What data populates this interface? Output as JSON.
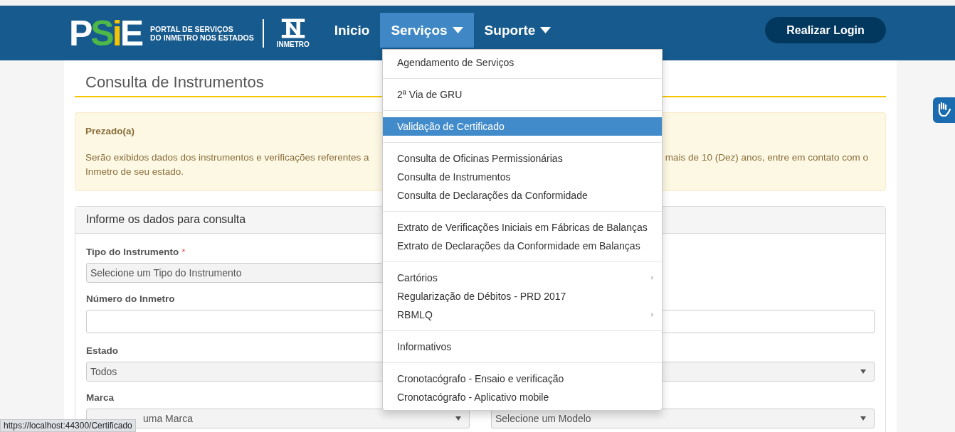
{
  "header": {
    "logo": {
      "letters": [
        {
          "text": "P",
          "color": "#ffffff"
        },
        {
          "text": "S",
          "color": "#4db848"
        },
        {
          "text": "i",
          "color": "#f6c400"
        },
        {
          "text": "E",
          "color": "#ffffff"
        }
      ],
      "tagline": [
        "PORTAL DE SERVIÇOS",
        "DO INMETRO NOS ESTADOS"
      ],
      "brand": "INMETRO"
    },
    "nav": [
      {
        "label": "Inicio",
        "selected": false,
        "has_dropdown": false
      },
      {
        "label": "Serviços",
        "selected": true,
        "has_dropdown": true
      },
      {
        "label": "Suporte",
        "selected": false,
        "has_dropdown": true
      }
    ],
    "login_button": "Realizar Login"
  },
  "page_title": "Consulta de Instrumentos",
  "alert": {
    "title": "Prezado(a)",
    "line_1_left": "Serão exibidos dados dos instrumentos e verificações referentes a",
    "line_1_right": "mais de 10 (Dez) anos, entre em contato com o",
    "line_2": "Inmetro de seu estado."
  },
  "form": {
    "title": "Informe os dados para consulta",
    "rows": [
      {
        "fields": [
          {
            "kind": "short_select",
            "label": "Tipo do Instrumento",
            "required_mark": "*",
            "placeholder": "Selecione um Tipo do Instrumento"
          }
        ]
      },
      {
        "fields": [
          {
            "kind": "input",
            "label": "Número do Inmetro"
          }
        ]
      },
      {
        "fields": [
          {
            "kind": "select",
            "label": "Estado",
            "value": "Todos"
          }
        ]
      },
      {
        "fields": [
          {
            "kind": "covered_select",
            "label": "Marca",
            "placeholder": "uma Marca"
          },
          {
            "kind": "select",
            "placeholder": "Selecione um Modelo"
          }
        ]
      }
    ]
  },
  "services_menu": {
    "groups": [
      [
        {
          "label": "Agendamento de Serviços",
          "selected": false,
          "has_submenu": false
        }
      ],
      [
        {
          "label": "2ª Via de GRU",
          "selected": false,
          "has_submenu": false
        }
      ],
      [
        {
          "label": "Validação de Certificado",
          "selected": true,
          "has_submenu": false
        }
      ],
      [
        {
          "label": "Consulta de Oficinas Permissionárias",
          "selected": false,
          "has_submenu": false
        },
        {
          "label": "Consulta de Instrumentos",
          "selected": false,
          "has_submenu": false
        },
        {
          "label": "Consulta de Declarações da Conformidade",
          "selected": false,
          "has_submenu": false
        }
      ],
      [
        {
          "label": "Extrato de Verificações Iniciais em Fábricas de Balanças",
          "selected": false,
          "has_submenu": false
        },
        {
          "label": "Extrato de Declarações da Conformidade em Balanças",
          "selected": false,
          "has_submenu": false
        }
      ],
      [
        {
          "label": "Cartórios",
          "selected": false,
          "has_submenu": true
        },
        {
          "label": "Regularização de Débitos - PRD 2017",
          "selected": false,
          "has_submenu": false
        },
        {
          "label": "RBMLQ",
          "selected": false,
          "has_submenu": true
        }
      ],
      [
        {
          "label": "Informativos",
          "selected": false,
          "has_submenu": false
        }
      ],
      [
        {
          "label": "Cronotacógrafo - Ensaio e verificação",
          "selected": false,
          "has_submenu": false
        },
        {
          "label": "Cronotacógrafo - Aplicativo mobile",
          "selected": false,
          "has_submenu": false
        }
      ]
    ]
  },
  "status_bar": "https://localhost:44300/Certificado"
}
